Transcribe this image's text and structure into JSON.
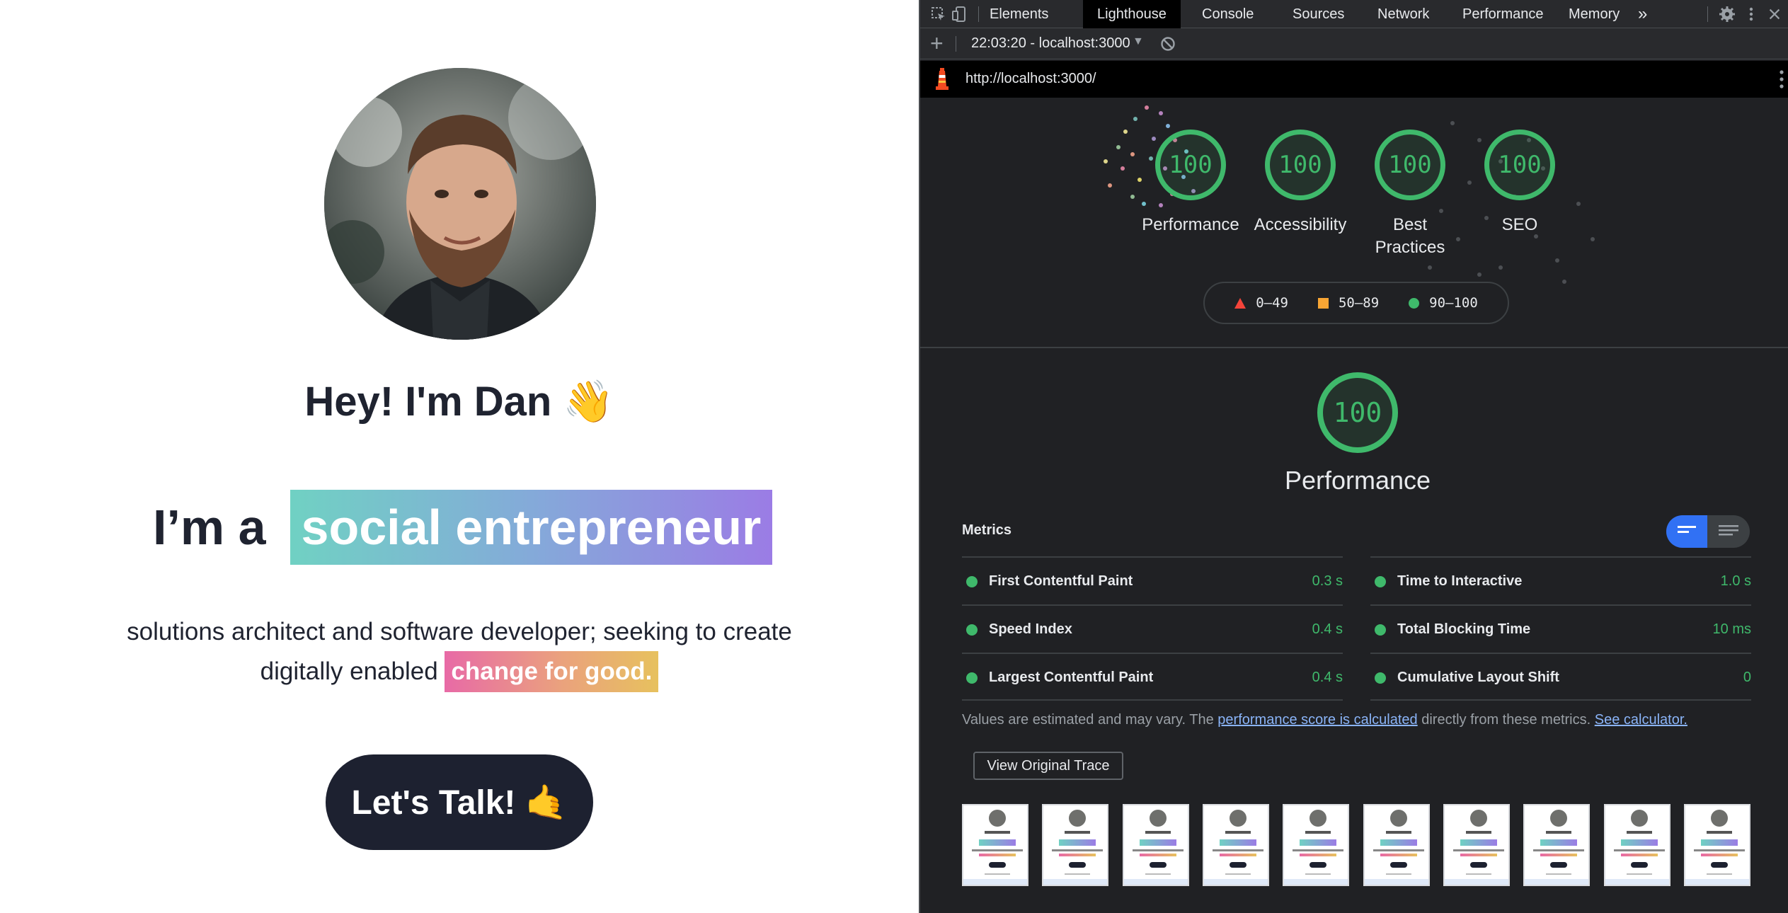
{
  "site": {
    "greeting": "Hey! I'm Dan 👋",
    "role_prefix": "I’m a",
    "role": "social entrepreneur",
    "tagline_start": "solutions architect and software developer; seeking to create",
    "tagline_mid": "digitally enabled",
    "tagline_highlight": "change for good.",
    "cta_label": "Let's Talk! 🤙"
  },
  "devtools": {
    "tabs": [
      {
        "label": "Elements",
        "active": false
      },
      {
        "label": "Lighthouse",
        "active": true
      },
      {
        "label": "Console",
        "active": false
      },
      {
        "label": "Sources",
        "active": false
      },
      {
        "label": "Network",
        "active": false
      },
      {
        "label": "Performance",
        "active": false
      },
      {
        "label": "Memory",
        "active": false
      }
    ],
    "more_tabs": "»",
    "report_select": "22:03:20 - localhost:3000",
    "url": "http://localhost:3000/"
  },
  "lighthouse": {
    "scores": [
      {
        "label": "Performance",
        "score": "100"
      },
      {
        "label": "Accessibility",
        "score": "100"
      },
      {
        "label": "Best",
        "label2": "Practices",
        "score": "100"
      },
      {
        "label": "SEO",
        "score": "100"
      }
    ],
    "legend": {
      "poor": "0–49",
      "average": "50–89",
      "good": "90–100"
    },
    "main_score": "100",
    "main_label": "Performance",
    "metrics_title": "Metrics",
    "metrics_left": [
      {
        "name": "First Contentful Paint",
        "value": "0.3 s"
      },
      {
        "name": "Speed Index",
        "value": "0.4 s"
      },
      {
        "name": "Largest Contentful Paint",
        "value": "0.4 s"
      }
    ],
    "metrics_right": [
      {
        "name": "Time to Interactive",
        "value": "1.0 s"
      },
      {
        "name": "Total Blocking Time",
        "value": "10 ms"
      },
      {
        "name": "Cumulative Layout Shift",
        "value": "0"
      }
    ],
    "note_start": "Values are estimated and may vary. The",
    "note_link1": "performance score is calculated",
    "note_mid": "directly from these metrics.",
    "note_link2": "See calculator.",
    "trace_button": "View Original Trace",
    "thumbnail_count": 10
  },
  "colors": {
    "good": "#3fb96b",
    "average": "#f7a534",
    "poor": "#f4443a",
    "link": "#8ab4f8",
    "cta_bg": "#1d2130"
  }
}
